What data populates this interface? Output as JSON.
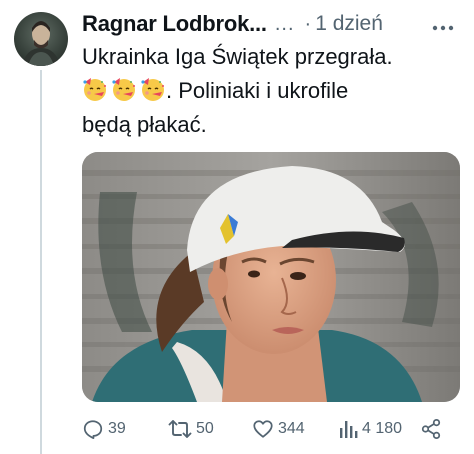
{
  "tweet": {
    "author_name": "Ragnar Lodbrok...",
    "more_dots": "...",
    "separator": "·",
    "time": "1 dzień",
    "more_icon": "more-options-icon",
    "text_line1": "Ukrainka Iga Świątek przegrała.",
    "text_after_emoji": ". Poliniaki i ukrofile",
    "text_line3": "będą płakać.",
    "emoji": [
      "partying-face-emoji",
      "partying-face-emoji",
      "partying-face-emoji"
    ],
    "media": "photo-tennis-player-white-cap"
  },
  "actions": {
    "reply_count": "39",
    "retweet_count": "50",
    "like_count": "344",
    "views_count": "4 180",
    "icons": [
      "reply-icon",
      "retweet-icon",
      "like-icon",
      "views-icon",
      "share-icon"
    ]
  },
  "colors": {
    "text": "#0f1419",
    "secondary": "#536471",
    "thread_line": "#cfd9de"
  }
}
